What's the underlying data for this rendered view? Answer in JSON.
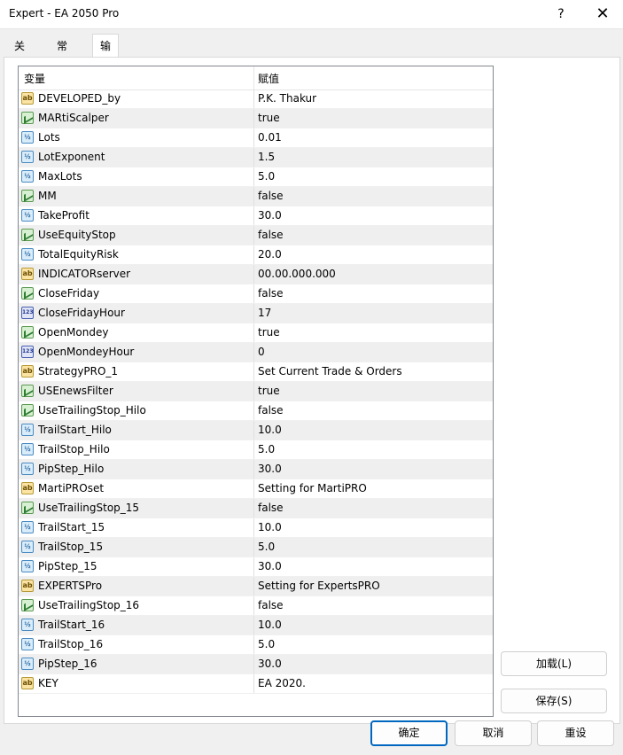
{
  "window": {
    "title": "Expert - EA 2050 Pro",
    "help_glyph": "?",
    "close_glyph": "✕"
  },
  "tabs": [
    {
      "label": "关于"
    },
    {
      "label": "常用"
    },
    {
      "label": "输入参数"
    }
  ],
  "grid": {
    "headers": {
      "variable": "变量",
      "value": "赋值"
    },
    "rows": [
      {
        "type": "ab",
        "name": "DEVELOPED_by",
        "value": "P.K. Thakur"
      },
      {
        "type": "bool",
        "name": "MARtiScalper",
        "value": "true"
      },
      {
        "type": "dbl",
        "name": "Lots",
        "value": "0.01"
      },
      {
        "type": "dbl",
        "name": "LotExponent",
        "value": "1.5"
      },
      {
        "type": "dbl",
        "name": "MaxLots",
        "value": "5.0"
      },
      {
        "type": "bool",
        "name": "MM",
        "value": "false"
      },
      {
        "type": "dbl",
        "name": "TakeProfit",
        "value": "30.0"
      },
      {
        "type": "bool",
        "name": "UseEquityStop",
        "value": "false"
      },
      {
        "type": "dbl",
        "name": "TotalEquityRisk",
        "value": "20.0"
      },
      {
        "type": "ab",
        "name": "INDICATORserver",
        "value": "00.00.000.000"
      },
      {
        "type": "bool",
        "name": "CloseFriday",
        "value": "false"
      },
      {
        "type": "int",
        "name": "CloseFridayHour",
        "value": "17"
      },
      {
        "type": "bool",
        "name": "OpenMondey",
        "value": "true"
      },
      {
        "type": "int",
        "name": "OpenMondeyHour",
        "value": "0"
      },
      {
        "type": "ab",
        "name": "StrategyPRO_1",
        "value": "Set Current Trade & Orders"
      },
      {
        "type": "bool",
        "name": "USEnewsFilter",
        "value": "true"
      },
      {
        "type": "bool",
        "name": "UseTrailingStop_Hilo",
        "value": "false"
      },
      {
        "type": "dbl",
        "name": "TrailStart_Hilo",
        "value": "10.0"
      },
      {
        "type": "dbl",
        "name": "TrailStop_Hilo",
        "value": "5.0"
      },
      {
        "type": "dbl",
        "name": "PipStep_Hilo",
        "value": "30.0"
      },
      {
        "type": "ab",
        "name": "MartiPROset",
        "value": "Setting for MartiPRO"
      },
      {
        "type": "bool",
        "name": "UseTrailingStop_15",
        "value": "false"
      },
      {
        "type": "dbl",
        "name": "TrailStart_15",
        "value": "10.0"
      },
      {
        "type": "dbl",
        "name": "TrailStop_15",
        "value": "5.0"
      },
      {
        "type": "dbl",
        "name": "PipStep_15",
        "value": "30.0"
      },
      {
        "type": "ab",
        "name": "EXPERTSPro",
        "value": "Setting for ExpertsPRO"
      },
      {
        "type": "bool",
        "name": "UseTrailingStop_16",
        "value": "false"
      },
      {
        "type": "dbl",
        "name": "TrailStart_16",
        "value": "10.0"
      },
      {
        "type": "dbl",
        "name": "TrailStop_16",
        "value": "5.0"
      },
      {
        "type": "dbl",
        "name": "PipStep_16",
        "value": "30.0"
      },
      {
        "type": "ab",
        "name": "KEY",
        "value": "EA 2020."
      }
    ]
  },
  "icons": {
    "ab": "ab",
    "dbl": "½",
    "int": "123"
  },
  "side_buttons": {
    "load": "加载(L)",
    "save": "保存(S)"
  },
  "footer_buttons": {
    "ok": "确定",
    "cancel": "取消",
    "reset": "重设"
  }
}
